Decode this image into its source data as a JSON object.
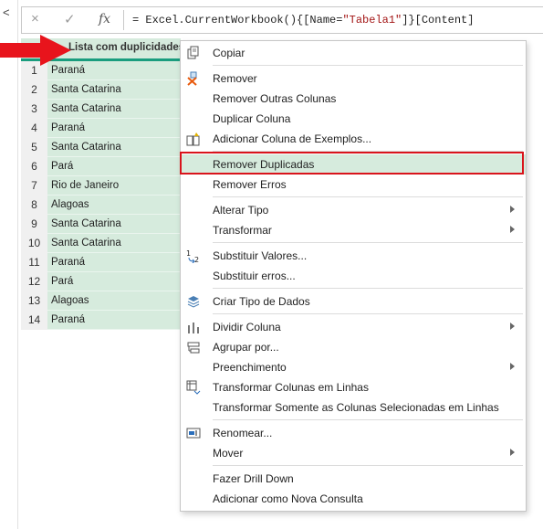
{
  "formula_bar": {
    "cancel_icon": "×",
    "check_icon": "✓",
    "fx_label": "fx",
    "formula_prefix": "= Excel.CurrentWorkbook(){[Name=",
    "formula_string": "\"Tabela1\"",
    "formula_suffix": "]}[Content]"
  },
  "left_panel": {
    "collapse_icon": "<"
  },
  "grid": {
    "column_header": "Lista com duplicidades",
    "rows": [
      {
        "idx": "1",
        "value": "Paraná"
      },
      {
        "idx": "2",
        "value": "Santa Catarina"
      },
      {
        "idx": "3",
        "value": "Santa Catarina"
      },
      {
        "idx": "4",
        "value": "Paraná"
      },
      {
        "idx": "5",
        "value": "Santa Catarina"
      },
      {
        "idx": "6",
        "value": "Pará"
      },
      {
        "idx": "7",
        "value": "Rio de Janeiro"
      },
      {
        "idx": "8",
        "value": "Alagoas"
      },
      {
        "idx": "9",
        "value": "Santa Catarina"
      },
      {
        "idx": "10",
        "value": "Santa Catarina"
      },
      {
        "idx": "11",
        "value": "Paraná"
      },
      {
        "idx": "12",
        "value": "Pará"
      },
      {
        "idx": "13",
        "value": "Alagoas"
      },
      {
        "idx": "14",
        "value": "Paraná"
      }
    ]
  },
  "menu": {
    "items": [
      {
        "label": "Copiar",
        "icon": "copy-icon"
      },
      {
        "label": "Remover",
        "icon": "remove-column-icon"
      },
      {
        "label": "Remover Outras Colunas",
        "icon": ""
      },
      {
        "label": "Duplicar Coluna",
        "icon": ""
      },
      {
        "label": "Adicionar Coluna de Exemplos...",
        "icon": "column-from-examples-icon"
      },
      {
        "label": "Remover Duplicadas",
        "icon": "",
        "highlighted": true
      },
      {
        "label": "Remover Erros",
        "icon": ""
      },
      {
        "label": "Alterar Tipo",
        "icon": "",
        "submenu": true
      },
      {
        "label": "Transformar",
        "icon": "",
        "submenu": true
      },
      {
        "label": "Substituir Valores...",
        "icon": "replace-values-icon"
      },
      {
        "label": "Substituir erros...",
        "icon": ""
      },
      {
        "label": "Criar Tipo de Dados",
        "icon": "data-type-icon"
      },
      {
        "label": "Dividir Coluna",
        "icon": "split-column-icon",
        "submenu": true
      },
      {
        "label": "Agrupar por...",
        "icon": "group-by-icon"
      },
      {
        "label": "Preenchimento",
        "icon": "",
        "submenu": true
      },
      {
        "label": "Transformar Colunas em Linhas",
        "icon": "unpivot-icon"
      },
      {
        "label": "Transformar Somente as Colunas Selecionadas em Linhas",
        "icon": ""
      },
      {
        "label": "Renomear...",
        "icon": "rename-icon"
      },
      {
        "label": "Mover",
        "icon": "",
        "submenu": true
      },
      {
        "label": "Fazer Drill Down",
        "icon": ""
      },
      {
        "label": "Adicionar como Nova Consulta",
        "icon": ""
      }
    ]
  },
  "colors": {
    "highlight_border": "#d9141c",
    "selection_fill": "#d6ebdd",
    "header_underline": "#1a9d7e",
    "arrow": "#e8141c"
  }
}
